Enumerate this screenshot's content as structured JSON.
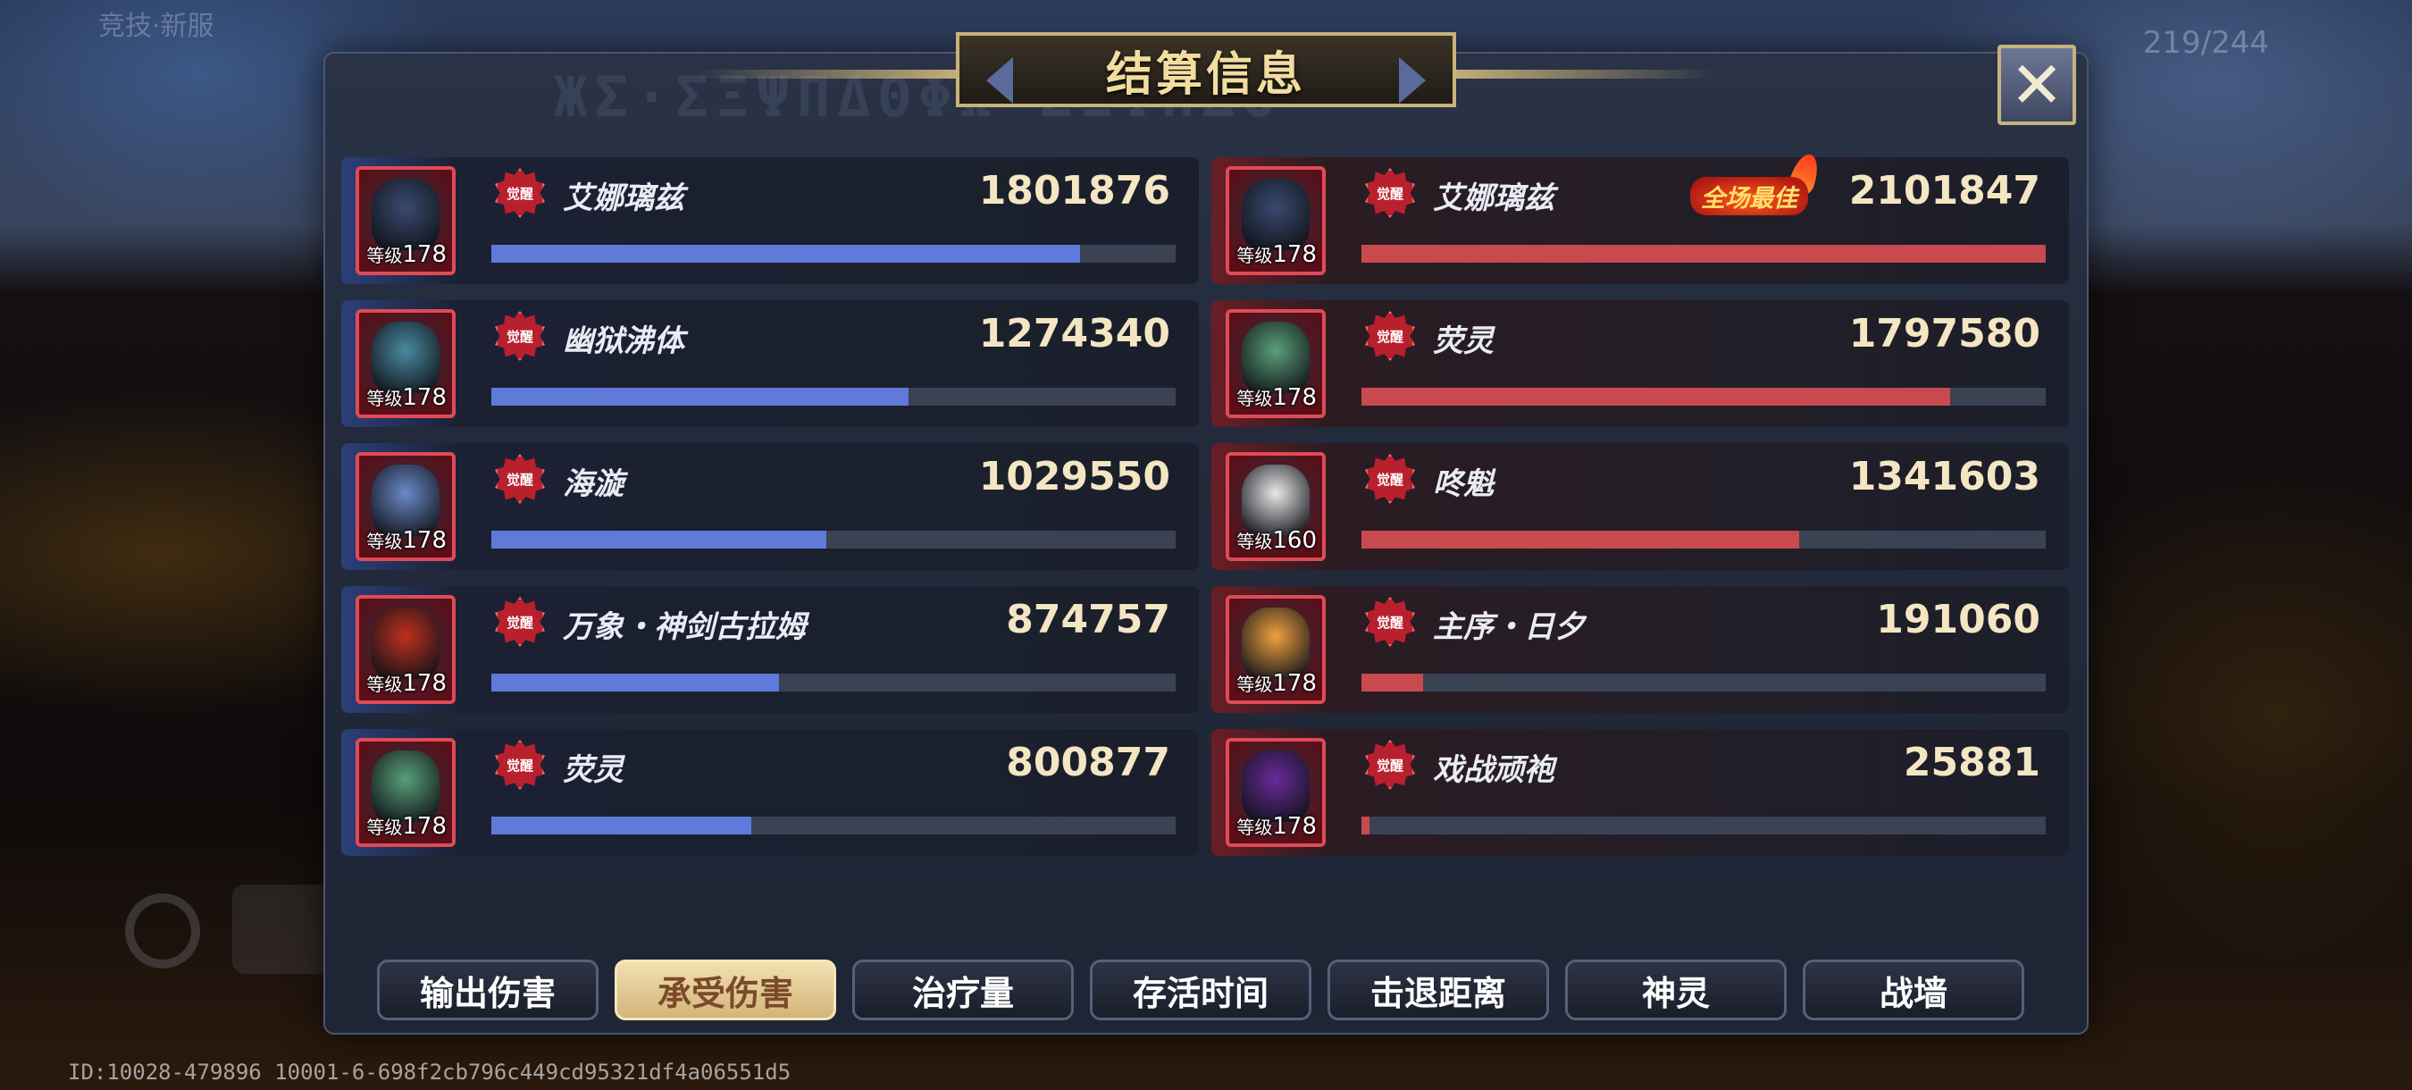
{
  "background": {
    "top_left_text": "竞技·新服",
    "top_right_text": "219/244",
    "id_line": "ID:10028-479896 10001-6-698f2cb796c449cd95321df4a06551d5"
  },
  "panel": {
    "title": "结算信息",
    "close_icon": "close-x-icon"
  },
  "awake_badge_label": "觉醒",
  "level_prefix": "等级",
  "best_label": "全场最佳",
  "left_team": [
    {
      "name": "艾娜璃兹",
      "value": "1801876",
      "level": "178",
      "fill": 0.86
    },
    {
      "name": "幽狱沸体",
      "value": "1274340",
      "level": "178",
      "fill": 0.61
    },
    {
      "name": "海漩",
      "value": "1029550",
      "level": "178",
      "fill": 0.49
    },
    {
      "name": "万象・神剑古拉姆",
      "value": "874757",
      "level": "178",
      "fill": 0.42
    },
    {
      "name": "荧灵",
      "value": "800877",
      "level": "178",
      "fill": 0.38
    }
  ],
  "right_team": [
    {
      "name": "艾娜璃兹",
      "value": "2101847",
      "level": "178",
      "fill": 1.0,
      "best": true
    },
    {
      "name": "荧灵",
      "value": "1797580",
      "level": "178",
      "fill": 0.86
    },
    {
      "name": "咚魁",
      "value": "1341603",
      "level": "160",
      "fill": 0.64
    },
    {
      "name": "主序・日夕",
      "value": "191060",
      "level": "178",
      "fill": 0.09
    },
    {
      "name": "戏战顽袍",
      "value": "25881",
      "level": "178",
      "fill": 0.012
    }
  ],
  "tabs": [
    {
      "label": "输出伤害",
      "active": false
    },
    {
      "label": "承受伤害",
      "active": true
    },
    {
      "label": "治疗量",
      "active": false
    },
    {
      "label": "存活时间",
      "active": false
    },
    {
      "label": "击退距离",
      "active": false
    },
    {
      "label": "神灵",
      "active": false
    },
    {
      "label": "战墙",
      "active": false
    }
  ],
  "colors": {
    "left_bar": "#5f7ad8",
    "right_bar": "#c84a4e",
    "value_text": "#f4e6c2",
    "title_text": "#f2dca0",
    "active_tab": "#e6cf98"
  },
  "portrait_art_colors": {
    "left": [
      "#3a4a70",
      "#4a8aa0",
      "#6a8ac8",
      "#c0301e",
      "#5aa07a"
    ],
    "right": [
      "#3a4a70",
      "#5aa07a",
      "#e8e8e8",
      "#f0a040",
      "#6a2a9a"
    ]
  }
}
